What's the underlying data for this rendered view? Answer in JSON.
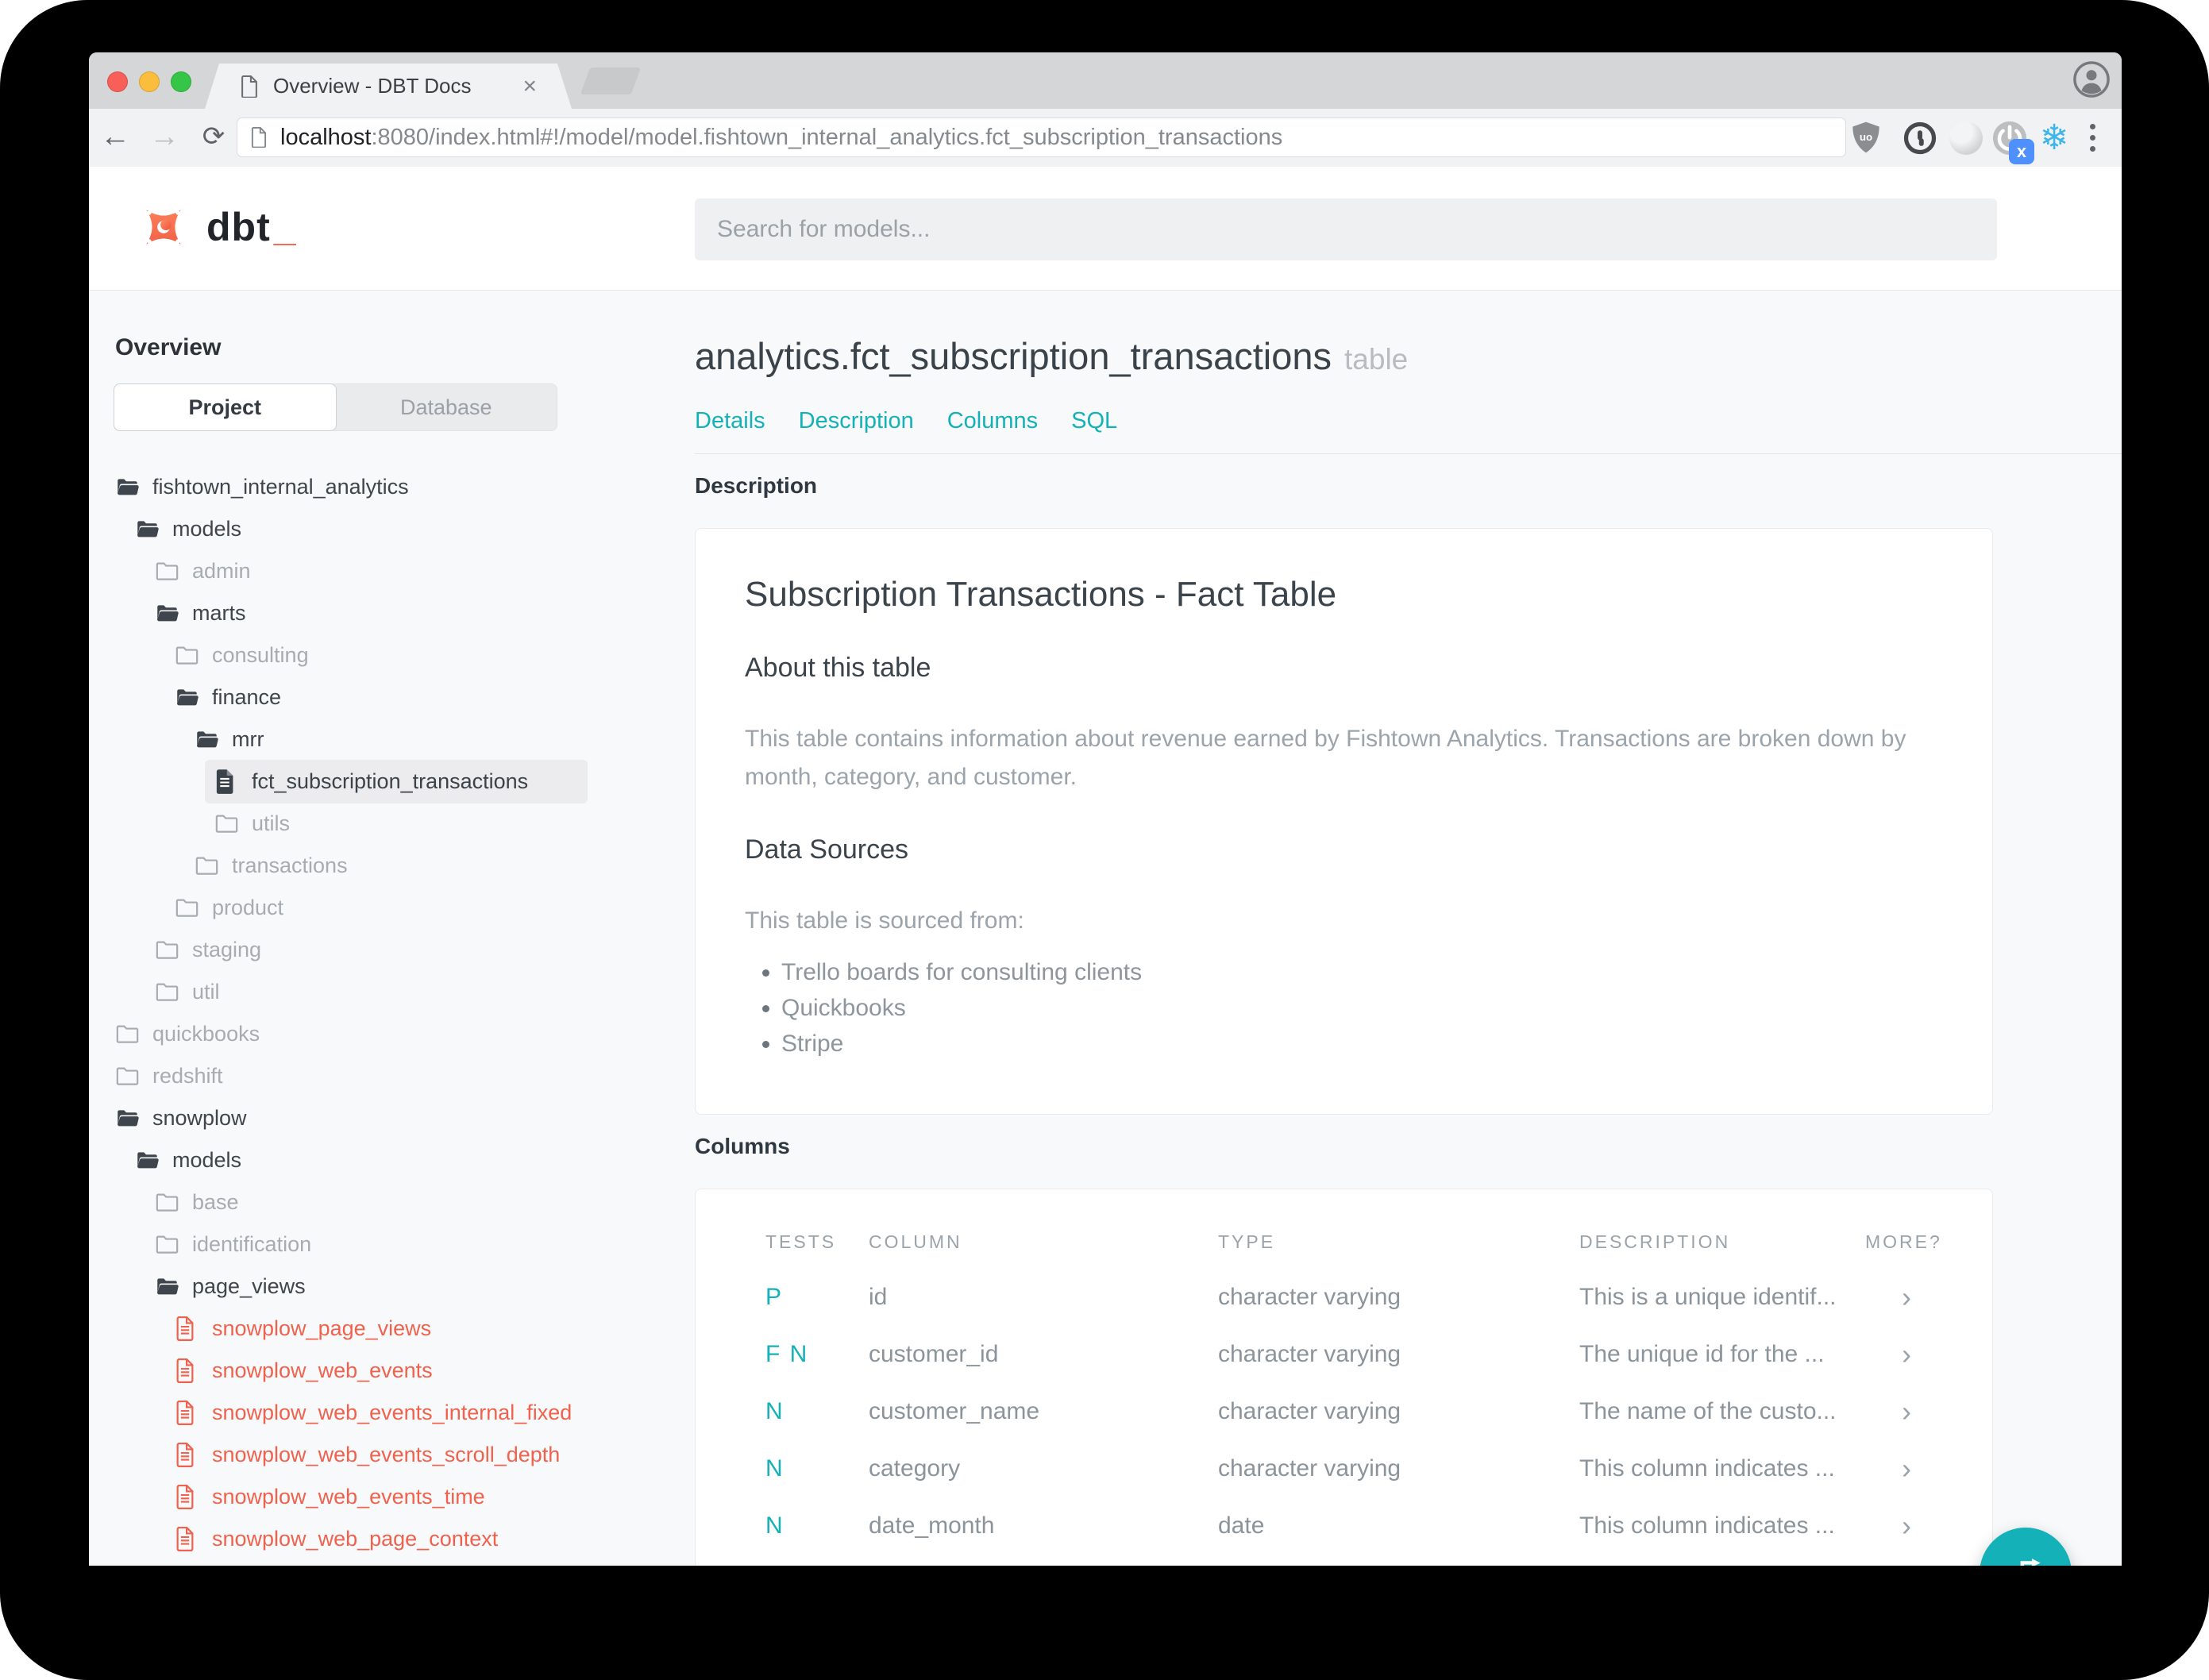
{
  "colors": {
    "accent_teal": "#14b1b9",
    "brand_orange": "#f0624d"
  },
  "browser": {
    "tab": {
      "title": "Overview - DBT Docs",
      "close_glyph": "×"
    },
    "nav": {
      "back_glyph": "←",
      "forward_glyph": "→",
      "reload_glyph": "⟳"
    },
    "url": {
      "host": "localhost",
      "rest": ":8080/index.html#!/model/model.fishtown_internal_analytics.fct_subscription_transactions"
    },
    "extensions": {
      "ublock_label": "uo",
      "power_badge": "x",
      "snowflake_glyph": "❄"
    }
  },
  "header": {
    "logo_text": "dbt",
    "logo_cursor": "_",
    "search_placeholder": "Search for models..."
  },
  "sidebar": {
    "heading": "Overview",
    "tabs": [
      {
        "label": "Project",
        "active": true
      },
      {
        "label": "Database",
        "active": false
      }
    ],
    "tree": [
      {
        "label": "fishtown_internal_analytics",
        "level": 0,
        "icon": "folder-open",
        "style": "open"
      },
      {
        "label": "models",
        "level": 1,
        "icon": "folder-open",
        "style": "open"
      },
      {
        "label": "admin",
        "level": 2,
        "icon": "folder-closed",
        "style": "muted"
      },
      {
        "label": "marts",
        "level": 2,
        "icon": "folder-open",
        "style": "open"
      },
      {
        "label": "consulting",
        "level": 3,
        "icon": "folder-closed",
        "style": "muted"
      },
      {
        "label": "finance",
        "level": 3,
        "icon": "folder-open",
        "style": "open"
      },
      {
        "label": "mrr",
        "level": 4,
        "icon": "folder-open",
        "style": "open"
      },
      {
        "label": "fct_subscription_transactions",
        "level": 5,
        "icon": "file",
        "style": "selected"
      },
      {
        "label": "utils",
        "level": 5,
        "icon": "folder-closed",
        "style": "muted"
      },
      {
        "label": "transactions",
        "level": 4,
        "icon": "folder-closed",
        "style": "muted"
      },
      {
        "label": "product",
        "level": 3,
        "icon": "folder-closed",
        "style": "muted"
      },
      {
        "label": "staging",
        "level": 2,
        "icon": "folder-closed",
        "style": "muted"
      },
      {
        "label": "util",
        "level": 2,
        "icon": "folder-closed",
        "style": "muted"
      },
      {
        "label": "quickbooks",
        "level": 0,
        "icon": "folder-closed",
        "style": "muted"
      },
      {
        "label": "redshift",
        "level": 0,
        "icon": "folder-closed",
        "style": "muted"
      },
      {
        "label": "snowplow",
        "level": 0,
        "icon": "folder-open",
        "style": "open"
      },
      {
        "label": "models",
        "level": 1,
        "icon": "folder-open",
        "style": "open"
      },
      {
        "label": "base",
        "level": 2,
        "icon": "folder-closed",
        "style": "muted"
      },
      {
        "label": "identification",
        "level": 2,
        "icon": "folder-closed",
        "style": "muted"
      },
      {
        "label": "page_views",
        "level": 2,
        "icon": "folder-open",
        "style": "open"
      },
      {
        "label": "snowplow_page_views",
        "level": 3,
        "icon": "file-red",
        "style": "error"
      },
      {
        "label": "snowplow_web_events",
        "level": 3,
        "icon": "file-red",
        "style": "error"
      },
      {
        "label": "snowplow_web_events_internal_fixed",
        "level": 3,
        "icon": "file-red",
        "style": "error"
      },
      {
        "label": "snowplow_web_events_scroll_depth",
        "level": 3,
        "icon": "file-red",
        "style": "error"
      },
      {
        "label": "snowplow_web_events_time",
        "level": 3,
        "icon": "file-red",
        "style": "error"
      },
      {
        "label": "snowplow_web_page_context",
        "level": 3,
        "icon": "file-red",
        "style": "error"
      }
    ]
  },
  "main": {
    "title": "analytics.fct_subscription_transactions",
    "title_badge": "table",
    "nav_links": [
      "Details",
      "Description",
      "Columns",
      "SQL"
    ],
    "description_section": {
      "heading": "Description",
      "card": {
        "title": "Subscription Transactions - Fact Table",
        "about_heading": "About this table",
        "about_text": "This table contains information about revenue earned by Fishtown Analytics. Transactions are broken down by month, category, and customer.",
        "sources_heading": "Data Sources",
        "sources_intro": "This table is sourced from:",
        "sources": [
          "Trello boards for consulting clients",
          "Quickbooks",
          "Stripe"
        ]
      }
    },
    "columns_section": {
      "heading": "Columns",
      "table": {
        "headers": [
          "TESTS",
          "COLUMN",
          "TYPE",
          "DESCRIPTION",
          "MORE?"
        ],
        "rows": [
          {
            "tests": "P",
            "column": "id",
            "type": "character varying",
            "description": "This is a unique identif...",
            "more": "›"
          },
          {
            "tests": "F N",
            "column": "customer_id",
            "type": "character varying",
            "description": "The unique id for the ...",
            "more": "›"
          },
          {
            "tests": "N",
            "column": "customer_name",
            "type": "character varying",
            "description": "The name of the custo...",
            "more": "›"
          },
          {
            "tests": "N",
            "column": "category",
            "type": "character varying",
            "description": "This column indicates ...",
            "more": "›"
          },
          {
            "tests": "N",
            "column": "date_month",
            "type": "date",
            "description": "This column indicates ...",
            "more": "›"
          }
        ]
      }
    }
  }
}
